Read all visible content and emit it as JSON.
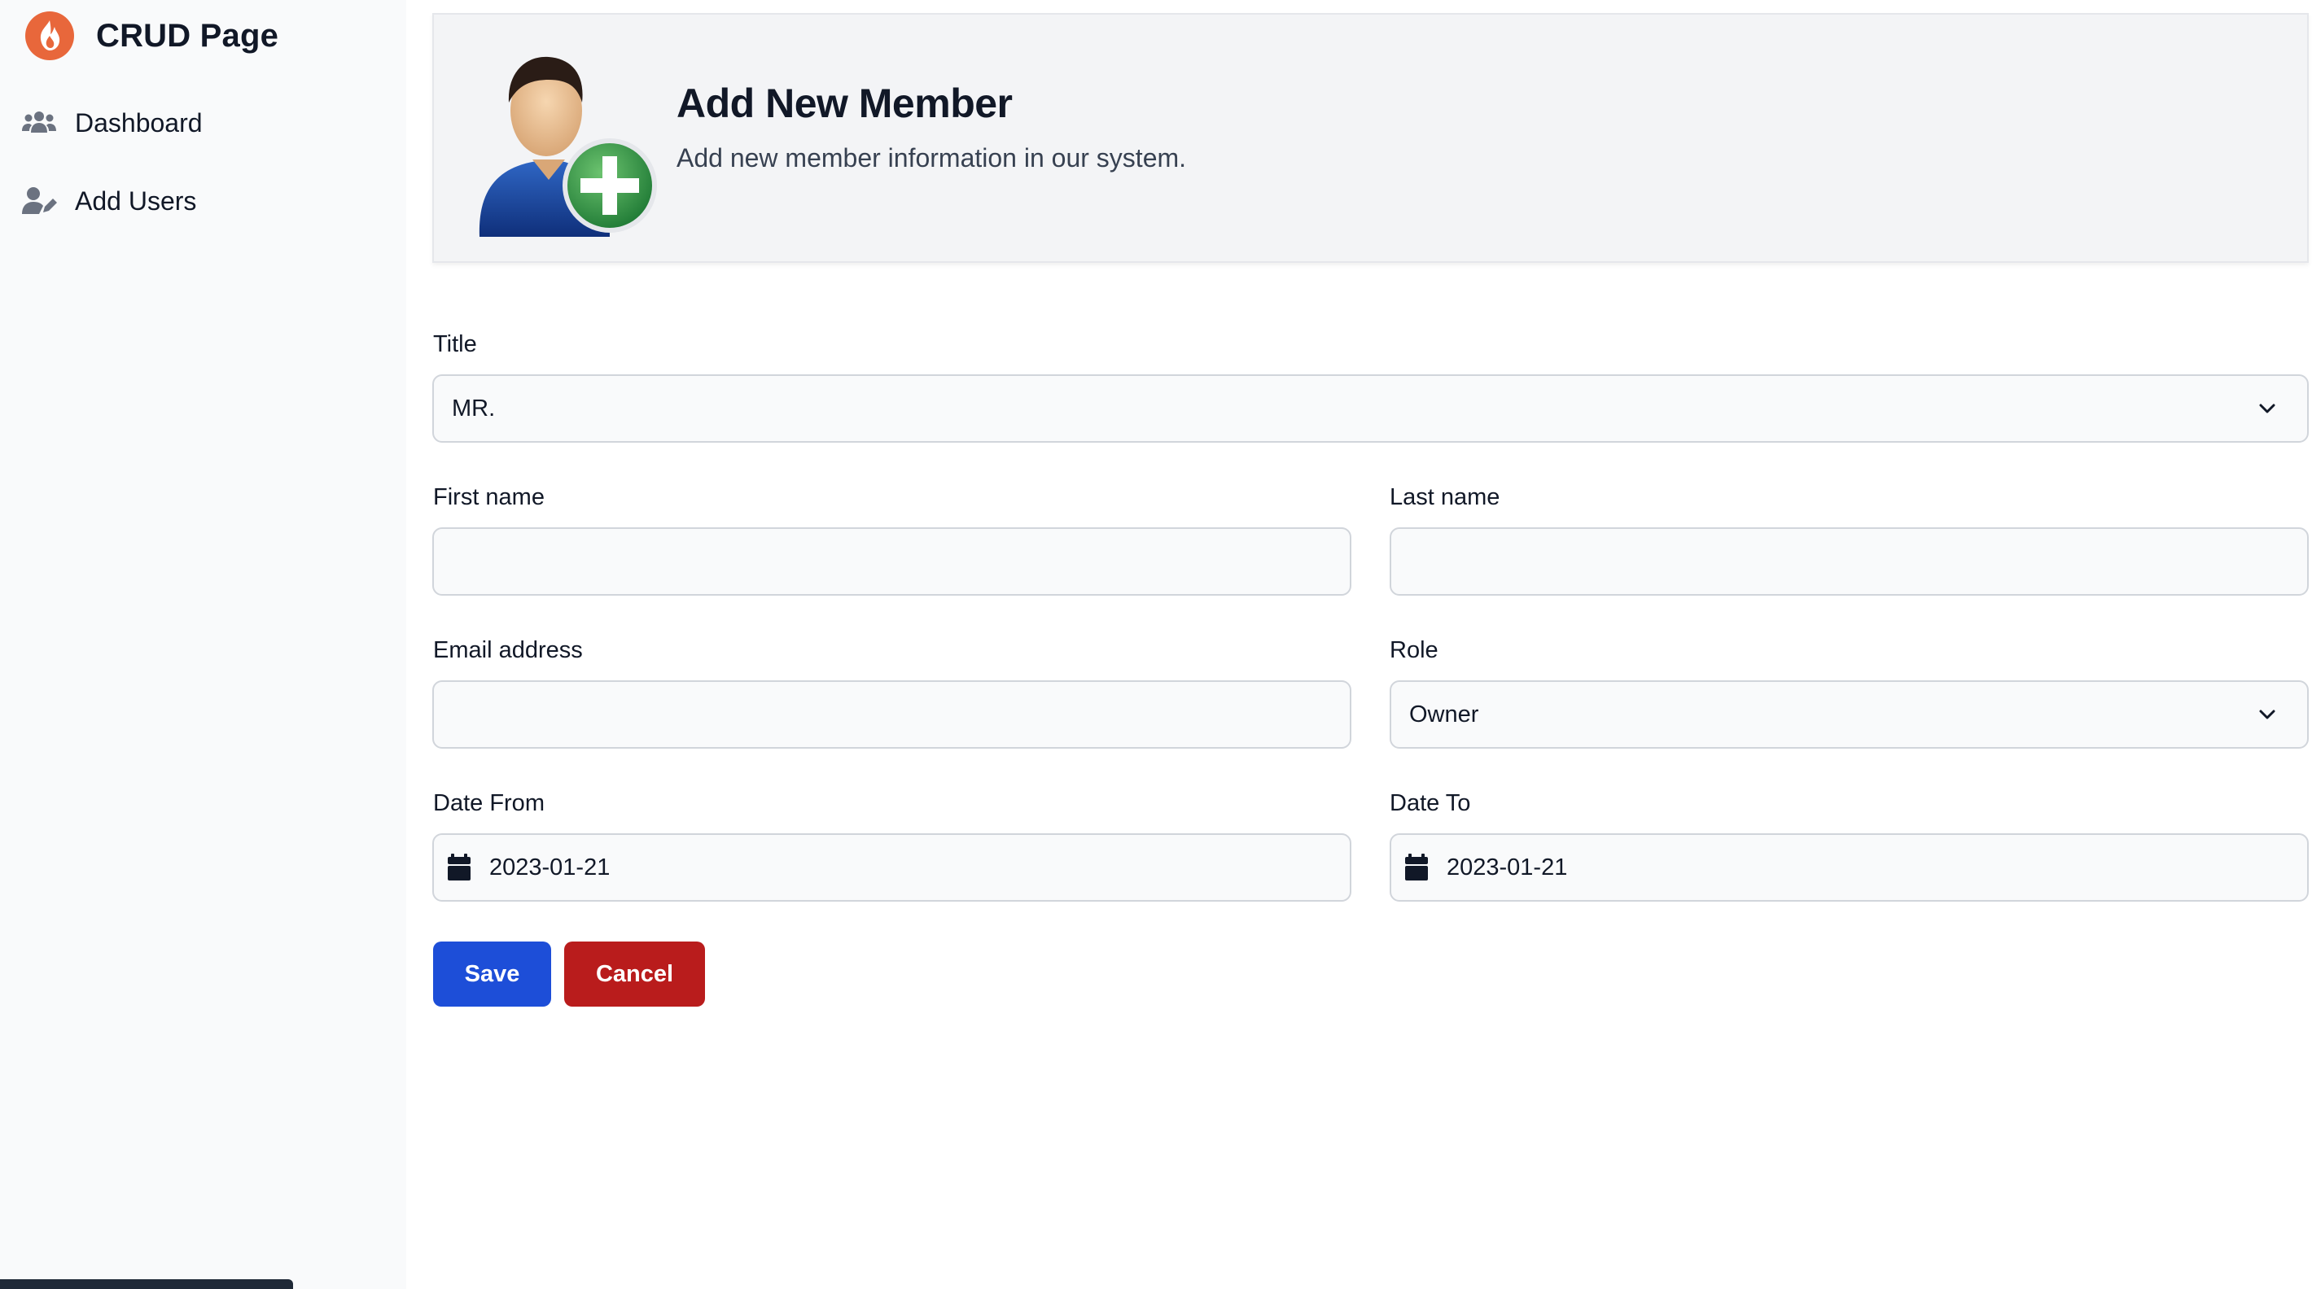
{
  "sidebar": {
    "brand_title": "CRUD Page",
    "brand_icon": "flame-logo-icon",
    "items": [
      {
        "label": "Dashboard",
        "icon": "users-group-icon"
      },
      {
        "label": "Add Users",
        "icon": "user-edit-icon"
      }
    ]
  },
  "header": {
    "title": "Add New Member",
    "subtitle": "Add new member information in our system.",
    "icon": "add-member-avatar-icon"
  },
  "form": {
    "title_label": "Title",
    "title_value": "MR.",
    "first_name_label": "First name",
    "first_name_value": "",
    "last_name_label": "Last name",
    "last_name_value": "",
    "email_label": "Email address",
    "email_value": "",
    "role_label": "Role",
    "role_value": "Owner",
    "date_from_label": "Date From",
    "date_from_value": "2023-01-21",
    "date_to_label": "Date To",
    "date_to_value": "2023-01-21"
  },
  "buttons": {
    "save_label": "Save",
    "cancel_label": "Cancel"
  },
  "colors": {
    "save": "#1d4ed8",
    "cancel": "#b91c1c",
    "brand": "#e8673b"
  }
}
